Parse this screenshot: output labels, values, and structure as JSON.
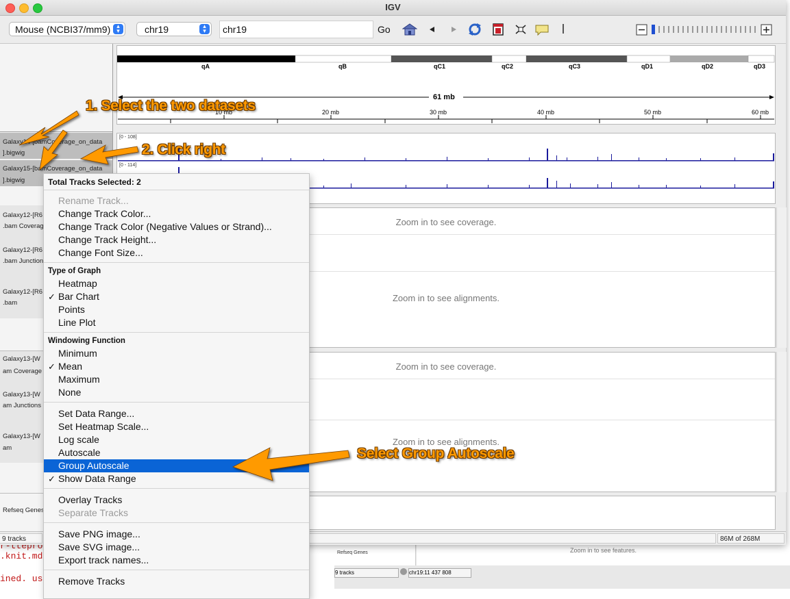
{
  "window": {
    "title": "IGV"
  },
  "toolbar": {
    "genome": "Mouse (NCBI37/mm9)",
    "chromosome": "chr19",
    "locus": "chr19",
    "go_label": "Go",
    "icons": [
      "home-icon",
      "back-arrow-icon",
      "forward-arrow-icon",
      "refresh-icon",
      "roi-icon",
      "resize-to-window-icon",
      "popup-info-icon",
      "zoom-out-icon",
      "zoom-slider",
      "zoom-in-icon"
    ]
  },
  "ideogram": {
    "bands": [
      "qA",
      "qB",
      "qC1",
      "qC2",
      "qC3",
      "qD1",
      "qD2",
      "qD3"
    ],
    "span_label": "61 mb",
    "ruler_ticks": [
      "10 mb",
      "20 mb",
      "30 mb",
      "40 mb",
      "50 mb",
      "60 mb"
    ]
  },
  "tracks": {
    "selected": [
      {
        "name": "Galaxy14-[bamCoverage_on_data",
        "suffix": "].bigwig",
        "range": "[0 - 108]"
      },
      {
        "name": "Galaxy15-[bamCoverage_on_data",
        "suffix": "].bigwig",
        "range": "[0 - 114]"
      }
    ],
    "group1": [
      {
        "name": "Galaxy12-[R6",
        "suffix": ".bam Coverage"
      },
      {
        "name": "Galaxy12-[R6",
        "suffix": ".bam Junctions"
      },
      {
        "name": "Galaxy12-[R6",
        "suffix": ".bam"
      }
    ],
    "group2": [
      {
        "name": "Galaxy13-[W",
        "suffix": "am Coverage"
      },
      {
        "name": "Galaxy13-[W",
        "suffix": "am Junctions"
      },
      {
        "name": "Galaxy13-[W",
        "suffix": "am"
      }
    ],
    "refseq": "Refseq Genes"
  },
  "messages": {
    "coverage": "Zoom in to see coverage.",
    "alignments": "Zoom in to see alignments.",
    "features": "Zoom in to see features."
  },
  "status": {
    "tracks": "9 tracks",
    "memory": "86M of 268M"
  },
  "background": {
    "editor_lines": [
      "r-ttepro",
      ".knit.md",
      "ined. use"
    ],
    "igv2_track": "Refseq Genes",
    "igv2_tracks": "9 tracks",
    "igv2_locus": "chr19:11 437 808"
  },
  "context_menu": {
    "header": "Total Tracks Selected: 2",
    "items_edit": [
      {
        "label": "Rename Track...",
        "enabled": false
      },
      {
        "label": "Change Track Color...",
        "enabled": true
      },
      {
        "label": "Change Track Color (Negative Values or Strand)...",
        "enabled": true
      },
      {
        "label": "Change Track Height...",
        "enabled": true
      },
      {
        "label": "Change Font Size...",
        "enabled": true
      }
    ],
    "graph_header": "Type of Graph",
    "graph_items": [
      "Heatmap",
      "Bar Chart",
      "Points",
      "Line Plot"
    ],
    "graph_checked": "Bar Chart",
    "window_header": "Windowing Function",
    "window_items": [
      "Minimum",
      "Mean",
      "Maximum",
      "None"
    ],
    "window_checked": "Mean",
    "data_items": [
      "Set Data Range...",
      "Set Heatmap Scale...",
      "Log scale",
      "Autoscale",
      "Group Autoscale",
      "Show Data Range"
    ],
    "data_highlighted": "Group Autoscale",
    "data_checked": "Show Data Range",
    "overlay_items": [
      {
        "label": "Overlay Tracks",
        "enabled": true
      },
      {
        "label": "Separate Tracks",
        "enabled": false
      }
    ],
    "export_items": [
      "Save PNG image...",
      "Save SVG image...",
      "Export track names..."
    ],
    "remove_item": "Remove Tracks"
  },
  "annotations": {
    "step1": "1. Select the two datasets",
    "step2": "2. Click right",
    "step3": "Select Group Autoscale",
    "color": "#ff9a00"
  }
}
